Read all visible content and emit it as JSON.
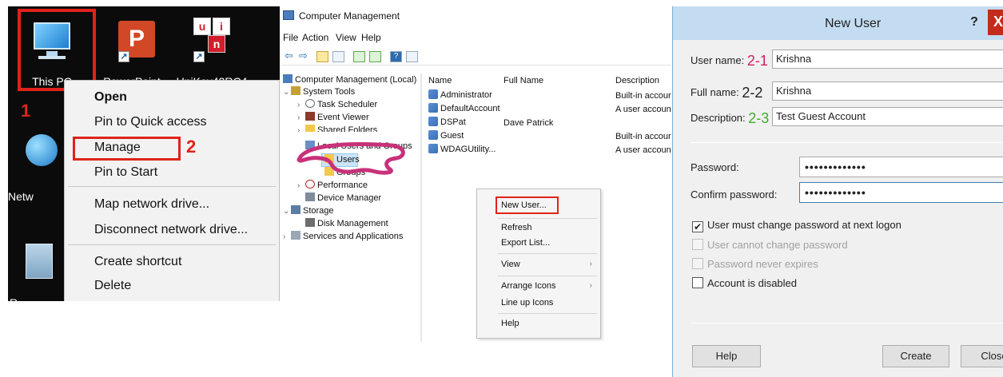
{
  "desktop": {
    "icons": [
      {
        "label": "This PC"
      },
      {
        "label": "PowerPoint"
      },
      {
        "label": "UniKey42RC4"
      },
      {
        "label": "Netw"
      },
      {
        "label": "R"
      }
    ],
    "ppt_glyph": "P",
    "unikey_glyphs": [
      "u",
      "i",
      "n"
    ],
    "step_labels": [
      "1",
      "2"
    ],
    "context_menu": {
      "items": [
        "Open",
        "Pin to Quick access",
        "Manage",
        "Pin to Start",
        "Map network drive...",
        "Disconnect network drive...",
        "Create shortcut",
        "Delete"
      ]
    }
  },
  "mmc": {
    "window_title": "Computer Management",
    "menu": [
      "File",
      "Action",
      "View",
      "Help"
    ],
    "tree": [
      "Computer Management (Local)",
      "System Tools",
      "Task Scheduler",
      "Event Viewer",
      "Shared Folders",
      "Local Users and Groups",
      "Users",
      "Groups",
      "Performance",
      "Device Manager",
      "Storage",
      "Disk Management",
      "Services and Applications"
    ],
    "columns": [
      "Name",
      "Full Name",
      "Description"
    ],
    "rows": [
      {
        "name": "Administrator",
        "full_name": "",
        "description": "Built-in accour"
      },
      {
        "name": "DefaultAccount",
        "full_name": "",
        "description": "A user account"
      },
      {
        "name": "DSPat",
        "full_name": "Dave Patrick",
        "description": ""
      },
      {
        "name": "Guest",
        "full_name": "",
        "description": "Built-in accour"
      },
      {
        "name": "WDAGUtility...",
        "full_name": "",
        "description": "A user account"
      }
    ],
    "context_menu": [
      "New User...",
      "Refresh",
      "Export List...",
      "View",
      "Arrange Icons",
      "Line up Icons",
      "Help"
    ]
  },
  "dialog": {
    "title": "New User",
    "help_glyph": "?",
    "close_glyph": "X",
    "username_label": "User name:",
    "username_step": "2-1",
    "username_value": "Krishna",
    "fullname_label": "Full name:",
    "fullname_step": "2-2",
    "fullname_value": "Krishna",
    "description_label": "Description:",
    "description_step": "2-3",
    "description_value": "Test Guest Account",
    "password_label": "Password:",
    "password_value": "•••••••••••••",
    "confirm_label": "Confirm password:",
    "confirm_value": "•••••••••••••",
    "checkboxes": [
      {
        "label": "User must change password at next logon",
        "checked": true,
        "enabled": true
      },
      {
        "label": "User cannot change password",
        "checked": false,
        "enabled": false
      },
      {
        "label": "Password never expires",
        "checked": false,
        "enabled": false
      },
      {
        "label": "Account is disabled",
        "checked": false,
        "enabled": true
      }
    ],
    "check_glyph": "✔",
    "buttons": {
      "help": "Help",
      "create": "Create",
      "close": "Close"
    }
  },
  "colors": {
    "annotation_red": "#e0221b",
    "pen_magenta": "#c8327a",
    "step_green": "#3fae2a",
    "dialog_title_bg": "#c3dcf1"
  }
}
